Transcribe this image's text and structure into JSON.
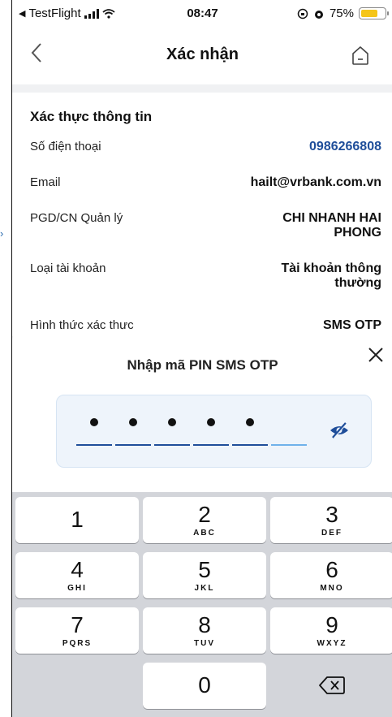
{
  "status": {
    "back_app": "TestFlight",
    "time": "08:47",
    "battery": "75%",
    "battery_level": 0.75
  },
  "header": {
    "title": "Xác nhận"
  },
  "info": {
    "heading": "Xác thực thông tin",
    "rows": [
      {
        "label": "Số điện thoại",
        "value": "0986266808"
      },
      {
        "label": "Email",
        "value": "hailt@vrbank.com.vn"
      },
      {
        "label": "PGD/CN Quản lý",
        "value_line1": "CHI NHANH HAI",
        "value_line2": "PHONG"
      },
      {
        "label": "Loại tài khoản",
        "value_line1": "Tài khoản thông",
        "value_line2": "thường"
      },
      {
        "label": "Hình thức xác thực",
        "value": "SMS OTP"
      }
    ]
  },
  "sheet": {
    "title": "Nhập mã PIN SMS OTP",
    "pin_filled": 5,
    "pin_length": 6
  },
  "keypad": {
    "keys": [
      {
        "num": "1",
        "sub": ""
      },
      {
        "num": "2",
        "sub": "ABC"
      },
      {
        "num": "3",
        "sub": "DEF"
      },
      {
        "num": "4",
        "sub": "GHI"
      },
      {
        "num": "5",
        "sub": "JKL"
      },
      {
        "num": "6",
        "sub": "MNO"
      },
      {
        "num": "7",
        "sub": "PQRS"
      },
      {
        "num": "8",
        "sub": "TUV"
      },
      {
        "num": "9",
        "sub": "WXYZ"
      },
      {
        "num": "0",
        "sub": ""
      }
    ]
  },
  "colors": {
    "accent": "#1f4e9a",
    "accent_light": "#6fb1ea",
    "battery": "#f5c518"
  },
  "icons": {
    "back": "chevron-left-icon",
    "home": "home-icon",
    "close": "close-icon",
    "eye": "eye-off-icon",
    "delete": "backspace-icon"
  }
}
